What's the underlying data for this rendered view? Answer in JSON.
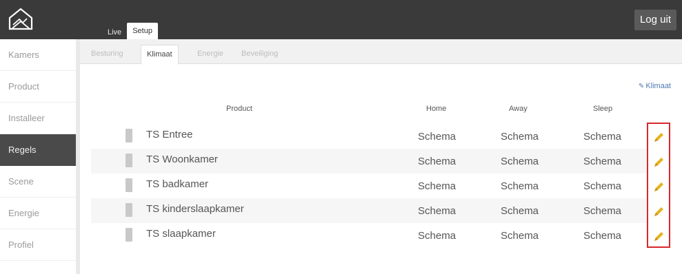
{
  "header": {
    "logo_icon": "house-logo-icon",
    "tabs": [
      {
        "label": "Live"
      },
      {
        "label": "Setup"
      }
    ],
    "logout_label": "Log uit"
  },
  "sidebar": {
    "items": [
      {
        "label": "Kamers"
      },
      {
        "label": "Product"
      },
      {
        "label": "Installeer"
      },
      {
        "label": "Regels"
      },
      {
        "label": "Scene"
      },
      {
        "label": "Energie"
      },
      {
        "label": "Profiel"
      }
    ]
  },
  "subtabs": [
    {
      "label": "Besturing"
    },
    {
      "label": "Klimaat"
    },
    {
      "label": "Energie"
    },
    {
      "label": "Beveiliging"
    }
  ],
  "klimaat_link": "Klimaat",
  "table": {
    "columns": [
      "Product",
      "Home",
      "Away",
      "Sleep"
    ],
    "rows": [
      {
        "name": "TS Entree",
        "home": "Schema",
        "away": "Schema",
        "sleep": "Schema"
      },
      {
        "name": "TS Woonkamer",
        "home": "Schema",
        "away": "Schema",
        "sleep": "Schema"
      },
      {
        "name": "TS badkamer",
        "home": "Schema",
        "away": "Schema",
        "sleep": "Schema"
      },
      {
        "name": "TS kinderslaapkamer",
        "home": "Schema",
        "away": "Schema",
        "sleep": "Schema"
      },
      {
        "name": "TS slaapkamer",
        "home": "Schema",
        "away": "Schema",
        "sleep": "Schema"
      }
    ]
  },
  "colors": {
    "topbar": "#3a3a3a",
    "active_sidebar": "#4a4a4a",
    "link": "#4f79b3",
    "highlight_frame": "#d9262c",
    "pencil": "#e6b422"
  }
}
